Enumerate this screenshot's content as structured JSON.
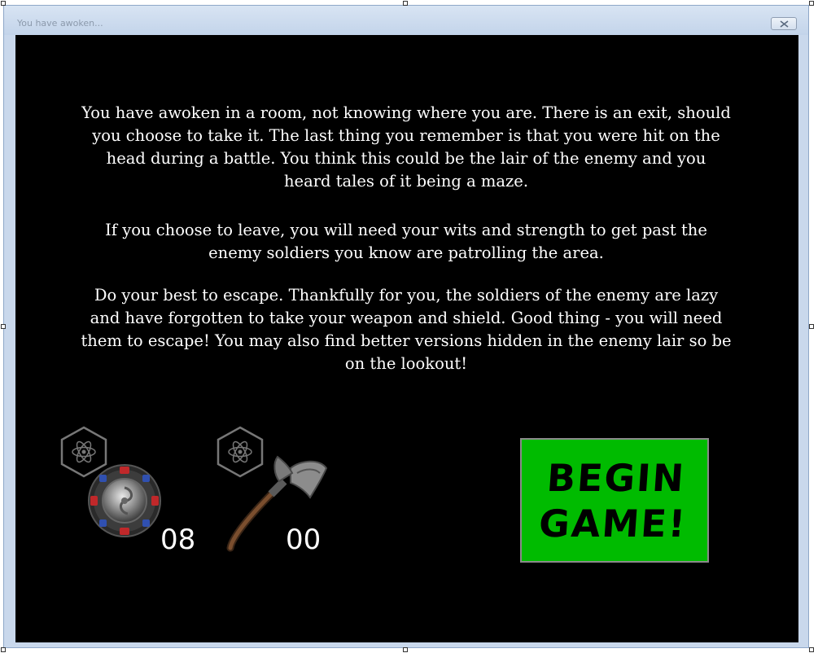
{
  "window": {
    "title": "You have awoken..."
  },
  "story": {
    "paragraph_1": "You have awoken in a room, not knowing where you are. There is an exit, should you choose to take it. The last thing you remember is that you were hit on the head during a battle. You think this could be the lair of the enemy and you heard tales of it being a maze.",
    "paragraph_2": "If you choose to leave, you will need your wits and strength to get past the enemy soldiers you know are patrolling the area.",
    "paragraph_3": "Do your best to escape. Thankfully for you, the soldiers of the enemy are lazy and have forgotten to take your weapon and shield. Good thing - you will need them to escape! You may also find better versions hidden in the enemy lair so be on the lookout!"
  },
  "inventory": {
    "shield": {
      "icon": "round-shield-icon",
      "badge_icon": "atom-hexagon-icon",
      "value": "08"
    },
    "weapon": {
      "icon": "battle-axe-icon",
      "badge_icon": "atom-hexagon-icon",
      "value": "00"
    }
  },
  "begin_button": {
    "label": "BEGIN GAME!",
    "color": "#00bb00"
  },
  "colors": {
    "window_bg": "#c9d8ec",
    "content_bg": "#000000",
    "text": "#ffffff"
  }
}
